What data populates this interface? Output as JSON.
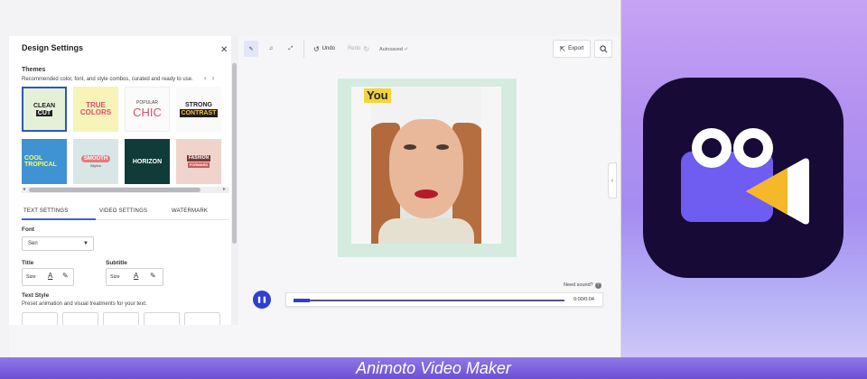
{
  "panel": {
    "title": "Design Settings",
    "close_icon": "close-icon",
    "themes_label": "Themes",
    "themes_desc": "Recommended color, font, and style combos, curated and ready to use.",
    "themes": [
      {
        "line1": "CLEAN",
        "line2": "CUT"
      },
      {
        "line1": "TRUE",
        "line2": "COLORS"
      },
      {
        "line1": "POPULAR",
        "line2": "CHIC"
      },
      {
        "line1": "STRONG",
        "line2": "CONTRAST"
      },
      {
        "line1": "COOL",
        "line2": "TROPICAL"
      },
      {
        "line1": "SMOOTH",
        "line2": "Styles"
      },
      {
        "line1": "HORIZON",
        "line2": ""
      },
      {
        "line1": "FASHION",
        "line2": "FORWARD"
      }
    ],
    "tabs": [
      "TEXT SETTINGS",
      "VIDEO SETTINGS",
      "WATERMARK"
    ],
    "font_label": "Font",
    "font_value": "Sen",
    "title_label": "Title",
    "subtitle_label": "Subtitle",
    "size_label": "Size",
    "text_style_label": "Text Style",
    "text_style_desc": "Preset animation and visual treatments for your text."
  },
  "toolbar": {
    "undo": "Undo",
    "redo": "Redo",
    "autosaved": "Autosaved",
    "export": "Export"
  },
  "canvas": {
    "text_overlay": "You"
  },
  "playback": {
    "need_sound": "Need sound?",
    "time": "0:00/0:04",
    "progress": 0.06
  },
  "caption": "Animoto Video Maker",
  "colors": {
    "accent": "#2f3fd0",
    "icon_bg": "#170a36",
    "icon_body": "#6f5cf0",
    "icon_lens": "#f5b82a"
  }
}
